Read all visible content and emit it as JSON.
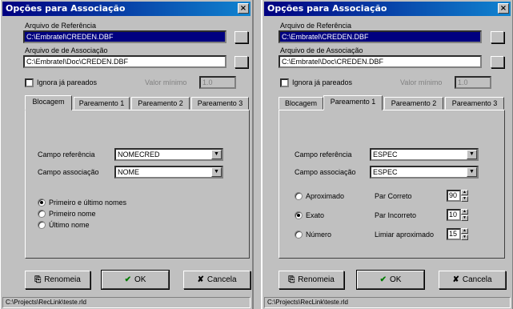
{
  "left": {
    "title": "Opções para Associação",
    "close": "×",
    "ref_label": "Arquivo de Referência",
    "ref_value": "C:\\Embratel\\CREDEN.DBF",
    "assoc_label": "Arquivo de de Associação",
    "assoc_value": "C:\\Embratel\\Doc\\CREDEN.DBF",
    "ignora_label": "Ignora já pareados",
    "valor_label": "Valor mínimo",
    "valor_value": "1.0",
    "tabs": [
      "Blocagem",
      "Pareamento 1",
      "Pareamento 2",
      "Pareamento 3"
    ],
    "campo_ref_label": "Campo referência",
    "campo_ref_value": "NOMECRED",
    "campo_assoc_label": "Campo associação",
    "campo_assoc_value": "NOME",
    "radios": [
      "Primeiro e último nomes",
      "Primeiro nome",
      "Último nome"
    ],
    "btn_renomeia": "Renomeia",
    "btn_ok": "OK",
    "btn_cancela": "Cancela",
    "status": "C:\\Projects\\RecLink\\teste.rld"
  },
  "right": {
    "title": "Opções para Associação",
    "close": "×",
    "ref_label": "Arquivo de Referência",
    "ref_value": "C:\\Embratel\\CREDEN.DBF",
    "assoc_label": "Arquivo de de Associação",
    "assoc_value": "C:\\Embratel\\Doc\\CREDEN.DBF",
    "ignora_label": "Ignora já pareados",
    "valor_label": "Valor mínimo",
    "valor_value": "1.0",
    "tabs": [
      "Blocagem",
      "Pareamento 1",
      "Pareamento 2",
      "Pareamento 3"
    ],
    "campo_ref_label": "Campo referência",
    "campo_ref_value": "ESPEC",
    "campo_assoc_label": "Campo associação",
    "campo_assoc_value": "ESPEC",
    "radios": [
      "Aproximado",
      "Exato",
      "Número"
    ],
    "par_correto_label": "Par Correto",
    "par_correto_value": "90",
    "par_incorreto_label": "Par Incorreto",
    "par_incorreto_value": "10",
    "limiar_label": "Limiar aproximado",
    "limiar_value": "15",
    "btn_renomeia": "Renomeia",
    "btn_ok": "OK",
    "btn_cancela": "Cancela",
    "status": "C:\\Projects\\RecLink\\teste.rld"
  }
}
